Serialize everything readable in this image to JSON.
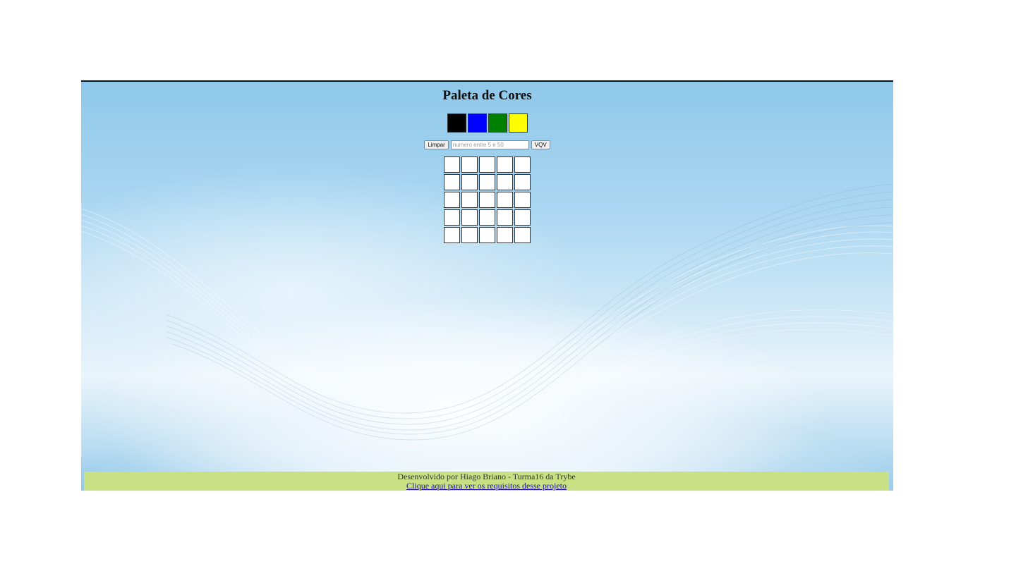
{
  "page": {
    "title": "Paleta de Cores"
  },
  "palette": {
    "colors": [
      {
        "name": "black",
        "hex": "#000000"
      },
      {
        "name": "blue",
        "hex": "#0000ff"
      },
      {
        "name": "green",
        "hex": "#008000"
      },
      {
        "name": "yellow",
        "hex": "#ffff00"
      }
    ]
  },
  "controls": {
    "clear_label": "Limpar",
    "size_placeholder": "numero entre 5 e 50",
    "generate_label": "VQV"
  },
  "board": {
    "rows": 5,
    "columns": 5,
    "pixel_color": "#ffffff"
  },
  "footer": {
    "credit": "Desenvolvido por Hiago Briano - Turma16 da Trybe",
    "link_text": "Clique aqui para ver os requisitos desse projeto",
    "background": "#c9e184"
  }
}
